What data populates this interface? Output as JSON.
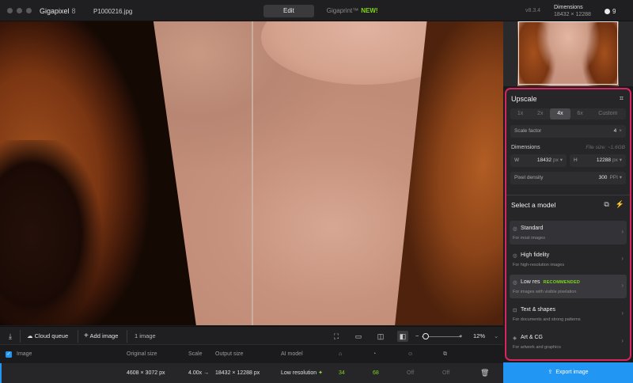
{
  "titlebar": {
    "app_name": "Gigapixel",
    "app_version": "8",
    "file_name": "P1000216.jpg",
    "tabs": [
      {
        "label": "Edit",
        "active": true
      },
      {
        "label": "Gigaprint™",
        "badge": "NEW!",
        "active": false
      }
    ],
    "version": "v8.3.4",
    "dimensions_label": "Dimensions",
    "dimensions_value": "18432 × 12288",
    "credits": "9"
  },
  "upscale": {
    "title": "Upscale",
    "scale_options": [
      "1x",
      "2x",
      "4x",
      "6x",
      "Custom"
    ],
    "selected_scale": "4x",
    "scale_factor_label": "Scale factor",
    "scale_factor_value": "4",
    "scale_factor_unit": "×",
    "dimensions_label": "Dimensions",
    "file_size": "File size: ~1.6GB",
    "width_label": "W",
    "width_value": "18432",
    "width_unit": "px",
    "height_label": "H",
    "height_value": "12288",
    "height_unit": "px",
    "density_label": "Pixel density",
    "density_value": "300",
    "density_unit": "PPI"
  },
  "models": {
    "title": "Select a model",
    "items": [
      {
        "name": "Standard",
        "desc": "For most images",
        "badge": ""
      },
      {
        "name": "High fidelity",
        "desc": "For high-resolution images",
        "badge": ""
      },
      {
        "name": "Low res",
        "desc": "For images with visible pixelation",
        "badge": "RECOMMENDED"
      },
      {
        "name": "Text & shapes",
        "desc": "For documents and strong patterns",
        "badge": ""
      },
      {
        "name": "Art & CG",
        "desc": "For artwork and graphics",
        "badge": ""
      }
    ],
    "selected": "Low res"
  },
  "export_label": "Export image",
  "toolbar": {
    "cloud_queue": "Cloud queue",
    "add_image": "Add image",
    "image_count": "1 image",
    "zoom": "12%"
  },
  "table": {
    "headers": [
      "Image",
      "Original size",
      "Scale",
      "Output size",
      "AI model"
    ],
    "row": {
      "original_size": "4608 × 3072 px",
      "scale": "4.00x →",
      "output_size": "18432 × 12288 px",
      "ai_model": "Low resolution",
      "val1": "34",
      "val2": "68",
      "val3": "Off",
      "val4": "Off"
    }
  }
}
